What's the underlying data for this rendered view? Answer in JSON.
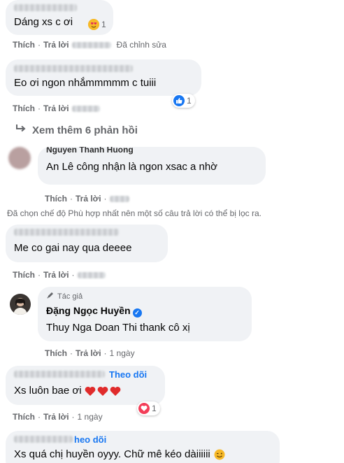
{
  "comments": [
    {
      "text": "Dáng xs c ơi",
      "reaction_count": "1",
      "reaction_icon": "heart-eyes-icon",
      "like": "Thích",
      "reply": "Trả lời",
      "edited": "Đã chỉnh sửa"
    },
    {
      "text": "Eo ơi ngon nhắmmmmm c tuiii",
      "reaction_count": "1",
      "reaction_icon": "thumbs-up-icon",
      "like": "Thích",
      "reply": "Trả lời"
    },
    {
      "tag": "Nguyen Thanh Huong",
      "text": "An Lê công nhận là ngon xsac a nhờ",
      "like": "Thích",
      "reply": "Trả lời"
    },
    {
      "text": "Me co gai nay qua deeee",
      "like": "Thích",
      "reply": "Trả lời"
    },
    {
      "author_badge": "Tác giả",
      "author": "Đặng Ngọc Huyền",
      "text": "Thuy Nga Doan Thi thank cô xị",
      "like": "Thích",
      "reply": "Trả lời",
      "time": "1 ngày"
    },
    {
      "follow": "Theo dõi",
      "text": "Xs luôn bae ơi",
      "reaction_count": "1",
      "reaction_icon": "love-icon",
      "like": "Thích",
      "reply": "Trả lời",
      "time": "1 ngày"
    },
    {
      "follow": "heo dõi",
      "text": "Xs quá chị huyền oyyy. Chữ mê kéo dàiiiiii"
    }
  ],
  "view_more": "Xem thêm 6 phản hồi",
  "filter_notice": "Đã chọn chế độ Phù hợp nhất nên một số câu trả lời có thể bị lọc ra.",
  "separator": "·",
  "colors": {
    "bubble": "#f0f2f5",
    "secondary_text": "#65676b",
    "link_blue": "#1877f2",
    "love_red": "#f33e58",
    "haha_yellow": "#f7b928"
  }
}
